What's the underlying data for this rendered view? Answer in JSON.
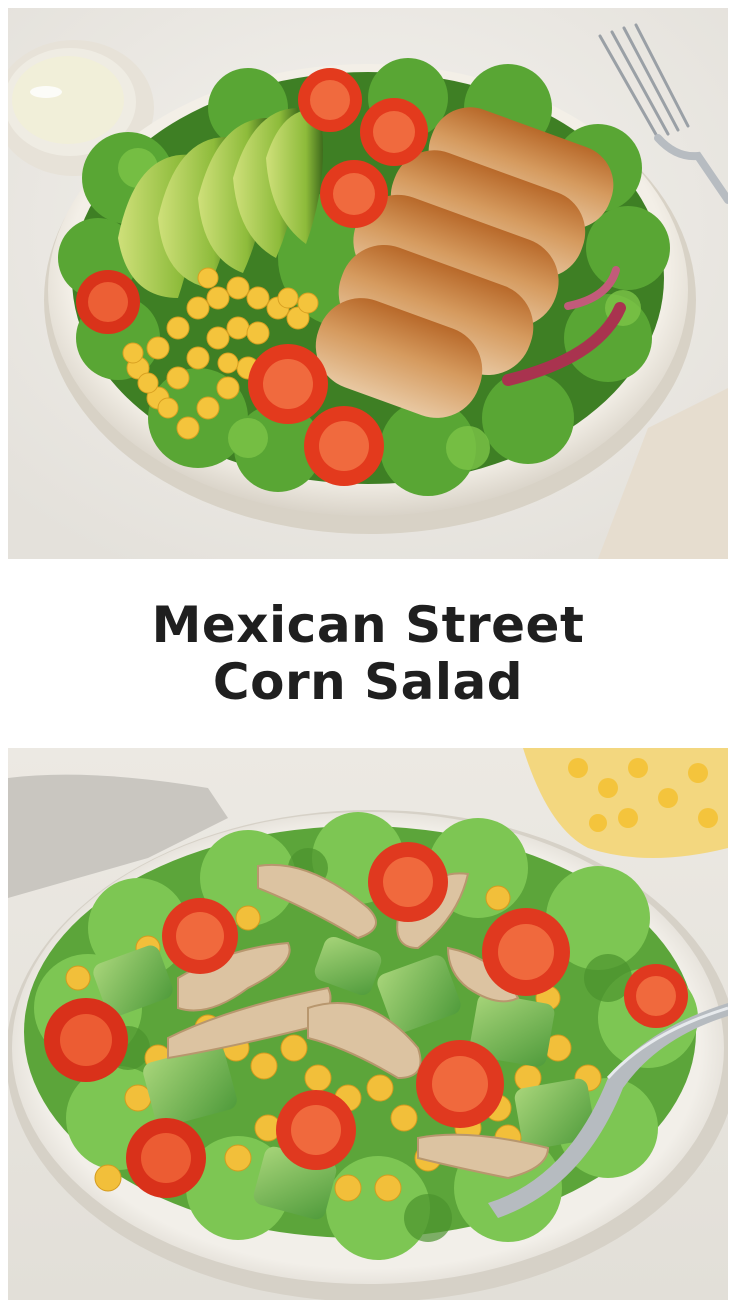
{
  "title": {
    "line1": "Mexican Street",
    "line2": "Corn Salad"
  },
  "colors": {
    "background": "#ffffff",
    "title_text": "#1f1f1f",
    "lettuce": "#4f9a2e",
    "tomato": "#e0391f",
    "corn": "#f2c13a",
    "avocado": "#8fbf3e",
    "chicken": "#c98a4e",
    "bowl": "#efebe3"
  },
  "images": {
    "top": {
      "icon": "salad-bowl-photo"
    },
    "bottom": {
      "icon": "salad-bowl-photo"
    }
  }
}
